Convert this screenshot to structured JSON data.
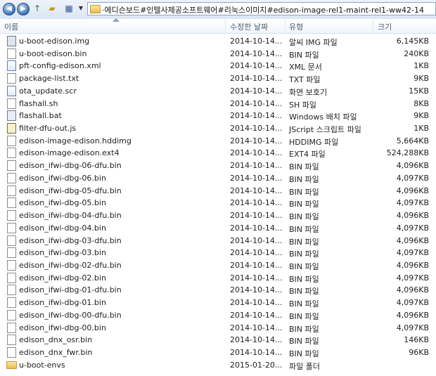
{
  "address": {
    "path": "·에디슨보드#인텔사제공소프트웨어#리눅스이미지#edison-image-rel1-maint-rel1-ww42-14"
  },
  "columns": {
    "name": "이름",
    "date": "수정한 날짜",
    "type": "유형",
    "size": "크기"
  },
  "files": [
    {
      "name": "u-boot-edison.img",
      "date": "2014-10-14...",
      "type": "알씨 IMG 파일",
      "size": "6,145KB",
      "icon": "img-file-icon"
    },
    {
      "name": "u-boot-edison.bin",
      "date": "2014-10-14...",
      "type": "BIN 파일",
      "size": "240KB",
      "icon": "generic-file-icon"
    },
    {
      "name": "pft-config-edison.xml",
      "date": "2014-10-14...",
      "type": "XML 문서",
      "size": "1KB",
      "icon": "xml-file-icon"
    },
    {
      "name": "package-list.txt",
      "date": "2014-10-14...",
      "type": "TXT 파일",
      "size": "9KB",
      "icon": "text-file-icon"
    },
    {
      "name": "ota_update.scr",
      "date": "2014-10-14...",
      "type": "화면 보호기",
      "size": "15KB",
      "icon": "screensaver-file-icon"
    },
    {
      "name": "flashall.sh",
      "date": "2014-10-14...",
      "type": "SH 파일",
      "size": "8KB",
      "icon": "generic-file-icon"
    },
    {
      "name": "flashall.bat",
      "date": "2014-10-14...",
      "type": "Windows 배치 파일",
      "size": "9KB",
      "icon": "batch-file-icon"
    },
    {
      "name": "filter-dfu-out.js",
      "date": "2014-10-14...",
      "type": "JScript 스크립트 파일",
      "size": "1KB",
      "icon": "script-file-icon"
    },
    {
      "name": "edison-image-edison.hddimg",
      "date": "2014-10-14...",
      "type": "HDDIMG 파일",
      "size": "5,664KB",
      "icon": "generic-file-icon"
    },
    {
      "name": "edison-image-edison.ext4",
      "date": "2014-10-14...",
      "type": "EXT4 파일",
      "size": "524,288KB",
      "icon": "generic-file-icon"
    },
    {
      "name": "edison_ifwi-dbg-06-dfu.bin",
      "date": "2014-10-14...",
      "type": "BIN 파일",
      "size": "4,096KB",
      "icon": "generic-file-icon"
    },
    {
      "name": "edison_ifwi-dbg-06.bin",
      "date": "2014-10-14...",
      "type": "BIN 파일",
      "size": "4,097KB",
      "icon": "generic-file-icon"
    },
    {
      "name": "edison_ifwi-dbg-05-dfu.bin",
      "date": "2014-10-14...",
      "type": "BIN 파일",
      "size": "4,096KB",
      "icon": "generic-file-icon"
    },
    {
      "name": "edison_ifwi-dbg-05.bin",
      "date": "2014-10-14...",
      "type": "BIN 파일",
      "size": "4,097KB",
      "icon": "generic-file-icon"
    },
    {
      "name": "edison_ifwi-dbg-04-dfu.bin",
      "date": "2014-10-14...",
      "type": "BIN 파일",
      "size": "4,096KB",
      "icon": "generic-file-icon"
    },
    {
      "name": "edison_ifwi-dbg-04.bin",
      "date": "2014-10-14...",
      "type": "BIN 파일",
      "size": "4,097KB",
      "icon": "generic-file-icon"
    },
    {
      "name": "edison_ifwi-dbg-03-dfu.bin",
      "date": "2014-10-14...",
      "type": "BIN 파일",
      "size": "4,096KB",
      "icon": "generic-file-icon"
    },
    {
      "name": "edison_ifwi-dbg-03.bin",
      "date": "2014-10-14...",
      "type": "BIN 파일",
      "size": "4,097KB",
      "icon": "generic-file-icon"
    },
    {
      "name": "edison_ifwi-dbg-02-dfu.bin",
      "date": "2014-10-14...",
      "type": "BIN 파일",
      "size": "4,096KB",
      "icon": "generic-file-icon"
    },
    {
      "name": "edison_ifwi-dbg-02.bin",
      "date": "2014-10-14...",
      "type": "BIN 파일",
      "size": "4,097KB",
      "icon": "generic-file-icon"
    },
    {
      "name": "edison_ifwi-dbg-01-dfu.bin",
      "date": "2014-10-14...",
      "type": "BIN 파일",
      "size": "4,096KB",
      "icon": "generic-file-icon"
    },
    {
      "name": "edison_ifwi-dbg-01.bin",
      "date": "2014-10-14...",
      "type": "BIN 파일",
      "size": "4,097KB",
      "icon": "generic-file-icon"
    },
    {
      "name": "edison_ifwi-dbg-00-dfu.bin",
      "date": "2014-10-14...",
      "type": "BIN 파일",
      "size": "4,096KB",
      "icon": "generic-file-icon"
    },
    {
      "name": "edison_ifwi-dbg-00.bin",
      "date": "2014-10-14...",
      "type": "BIN 파일",
      "size": "4,097KB",
      "icon": "generic-file-icon"
    },
    {
      "name": "edison_dnx_osr.bin",
      "date": "2014-10-14...",
      "type": "BIN 파일",
      "size": "146KB",
      "icon": "generic-file-icon"
    },
    {
      "name": "edison_dnx_fwr.bin",
      "date": "2014-10-14...",
      "type": "BIN 파일",
      "size": "96KB",
      "icon": "generic-file-icon"
    },
    {
      "name": "u-boot-envs",
      "date": "2015-01-20...",
      "type": "파일 폴더",
      "size": "",
      "icon": "folder-icon"
    }
  ]
}
